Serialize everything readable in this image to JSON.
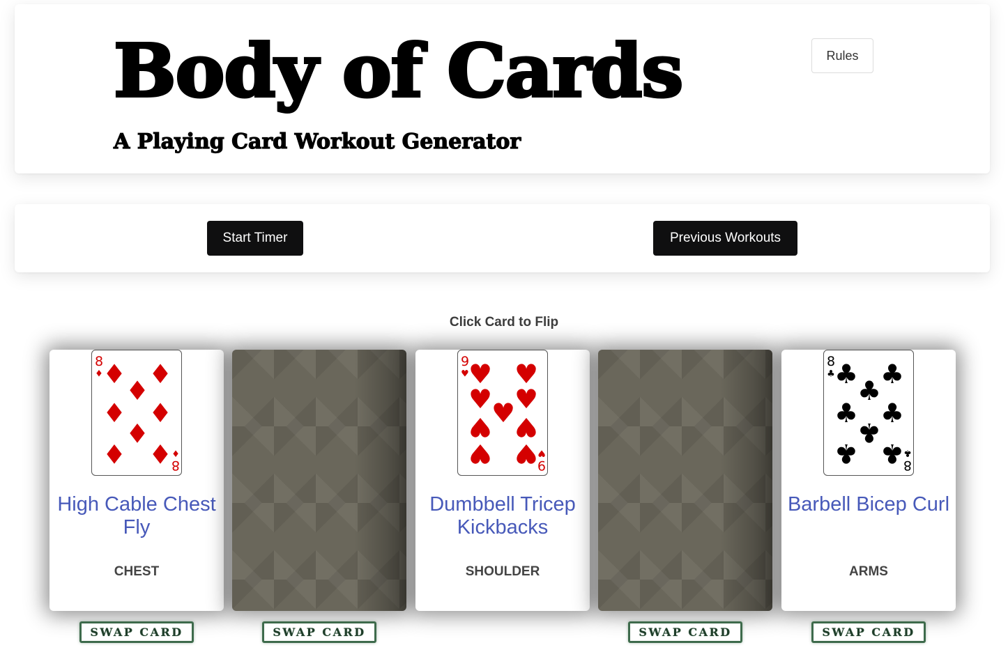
{
  "header": {
    "title": "Body of Cards",
    "subtitle": "A Playing Card Workout Generator",
    "rules_label": "Rules"
  },
  "controls": {
    "start_timer_label": "Start Timer",
    "previous_workouts_label": "Previous Workouts"
  },
  "hint": "Click Card to Flip",
  "colors": {
    "red_suit": "#d40000",
    "black_suit": "#000000",
    "exercise_link": "#4759b9",
    "swap_border": "#3e6b4c",
    "card_back": "#6a675b"
  },
  "cards": [
    {
      "face": "up",
      "rank": "8",
      "suit": "diamonds",
      "exercise": "High Cable Chest Fly",
      "muscle": "CHEST",
      "swap_label": "SWAP CARD"
    },
    {
      "face": "down",
      "swap_label": "SWAP CARD"
    },
    {
      "face": "up",
      "rank": "9",
      "suit": "hearts",
      "exercise": "Dumbbell Tricep Kickbacks",
      "muscle": "SHOULDER"
    },
    {
      "face": "down",
      "swap_label": "SWAP CARD"
    },
    {
      "face": "up",
      "rank": "8",
      "suit": "clubs",
      "exercise": "Barbell Bicep Curl",
      "muscle": "ARMS",
      "swap_label": "SWAP CARD"
    }
  ]
}
